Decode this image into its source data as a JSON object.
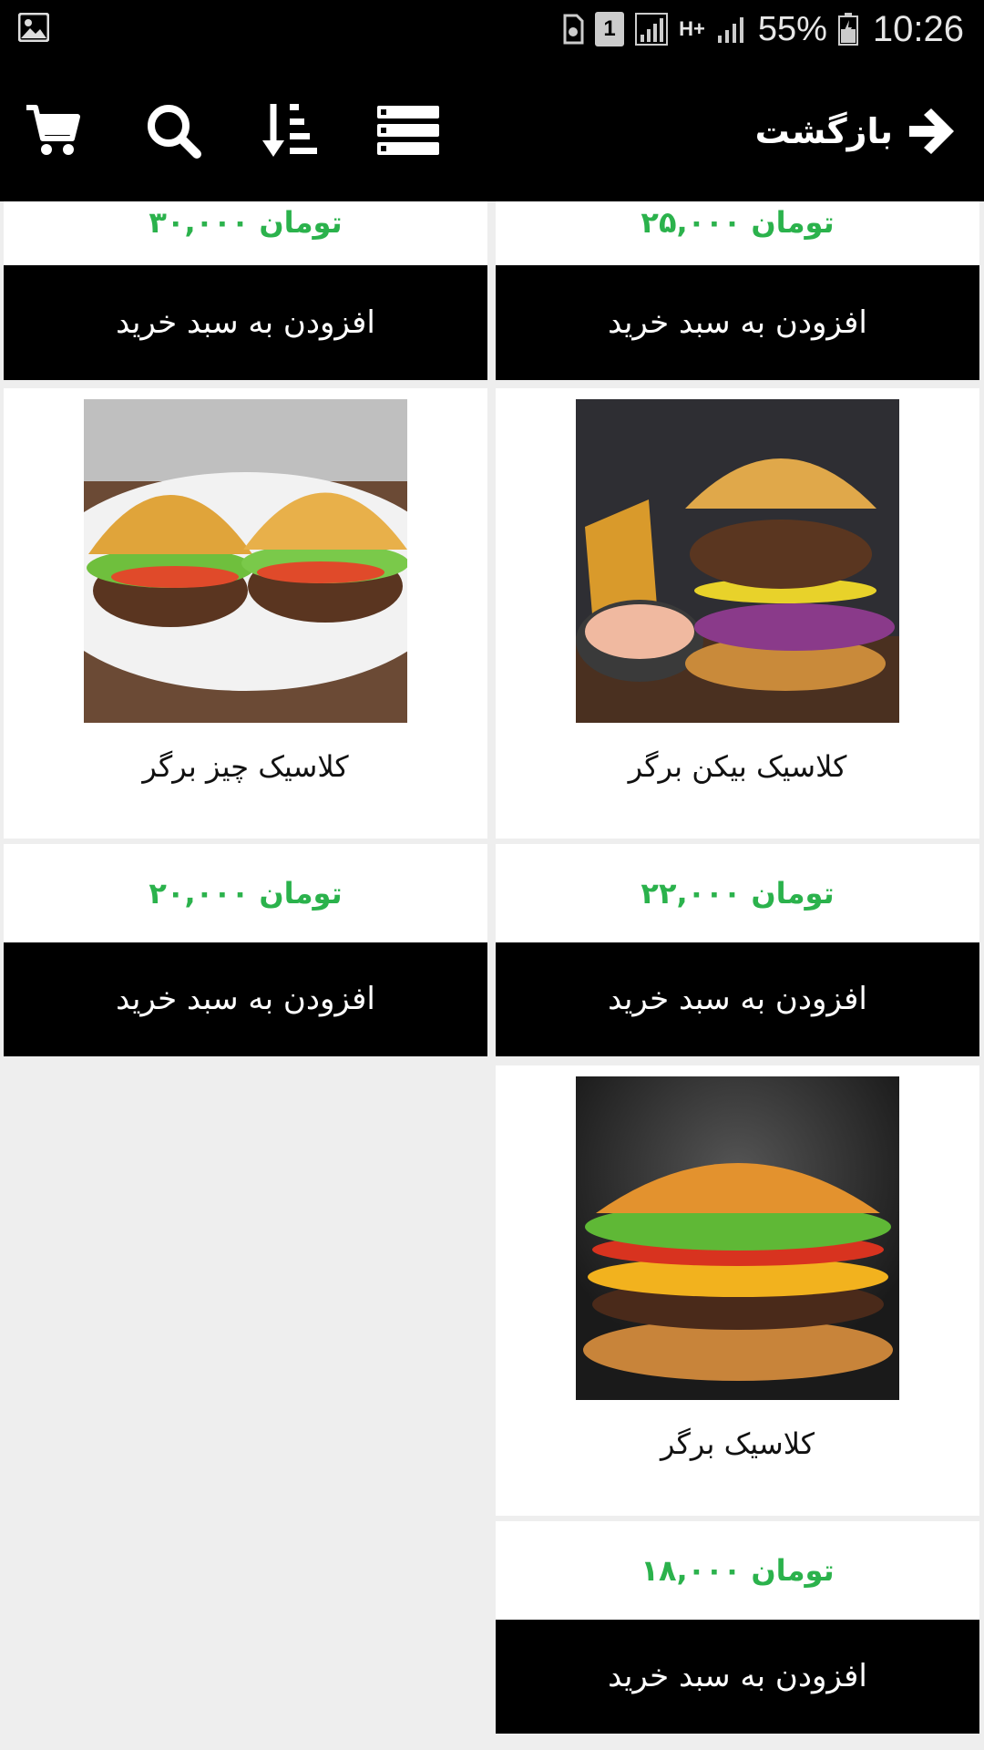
{
  "status_bar": {
    "battery": "55%",
    "time": "10:26",
    "sim_label": "1",
    "network": "H+",
    "icons": [
      "gallery-icon",
      "sim-icon",
      "signal-icon",
      "network-icon",
      "battery-icon"
    ]
  },
  "toolbar": {
    "back_label": "بازگشت",
    "icons": [
      "cart-icon",
      "search-icon",
      "sort-icon",
      "list-view-icon",
      "arrow-right-icon"
    ]
  },
  "add_to_cart_label": "افزودن به سبد خرید",
  "top_partial_row": [
    {
      "price": "۳۰,۰۰۰ تومان"
    },
    {
      "price": "۲۵,۰۰۰ تومان"
    }
  ],
  "products": [
    {
      "name": "کلاسیک چیز برگر",
      "price": "۲۰,۰۰۰ تومان",
      "image": "two-cheeseburgers-on-plate"
    },
    {
      "name": "کلاسیک بیکن برگر",
      "price": "۲۲,۰۰۰ تومان",
      "image": "bacon-burger-with-fries-and-sauce"
    },
    {
      "name": "کلاسیک برگر",
      "price": "۱۸,۰۰۰ تومان",
      "image": "classic-burger-dark-background"
    }
  ],
  "colors": {
    "toolbar_bg": "#000000",
    "price_green": "#2bb24c",
    "button_bg": "#000000",
    "page_bg": "#eeeeee"
  }
}
